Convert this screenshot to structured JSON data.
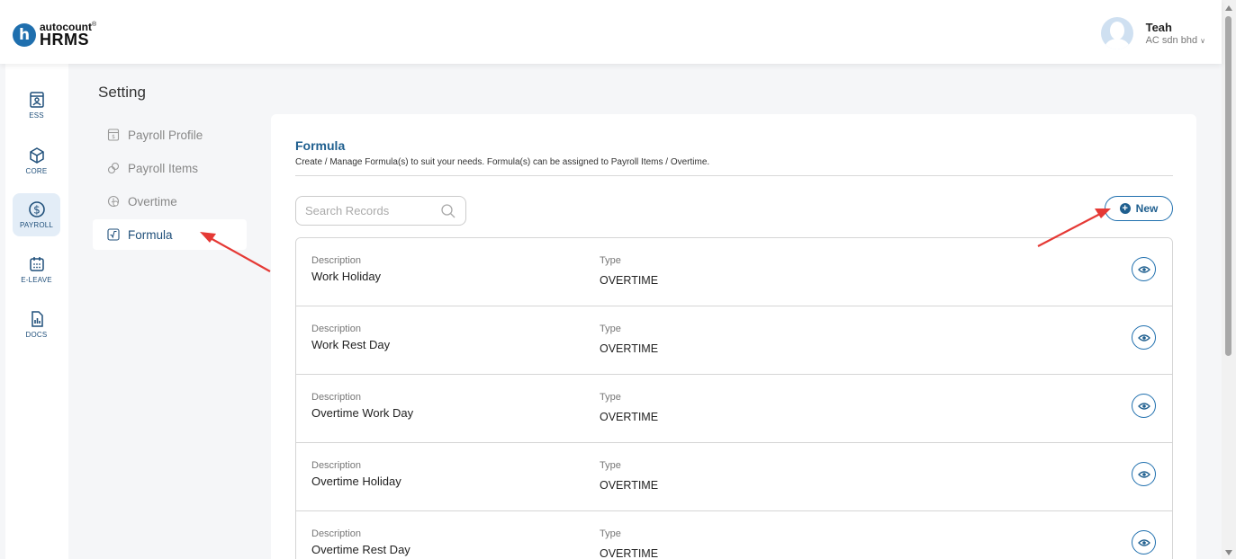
{
  "header": {
    "logo_brand": "autocount",
    "logo_product": "HRMS",
    "user_name": "Teah",
    "company": "AC sdn bhd"
  },
  "rail": {
    "items": [
      {
        "label": "ESS",
        "icon": "id-card-icon"
      },
      {
        "label": "CORE",
        "icon": "cube-icon"
      },
      {
        "label": "PAYROLL",
        "icon": "dollar-circle-icon",
        "active": true
      },
      {
        "label": "E-LEAVE",
        "icon": "calendar-icon"
      },
      {
        "label": "DOCS",
        "icon": "document-chart-icon"
      }
    ]
  },
  "setting": {
    "title": "Setting",
    "menu": [
      {
        "label": "Payroll Profile",
        "icon": "calculator-icon"
      },
      {
        "label": "Payroll Items",
        "icon": "coins-icon"
      },
      {
        "label": "Overtime",
        "icon": "clock-dollar-icon"
      },
      {
        "label": "Formula",
        "icon": "formula-icon",
        "active": true
      }
    ]
  },
  "formula": {
    "title": "Formula",
    "subtitle": "Create / Manage Formula(s) to suit your needs. Formula(s) can be assigned to Payroll Items / Overtime.",
    "search_placeholder": "Search Records",
    "new_label": "New",
    "col_description": "Description",
    "col_type": "Type",
    "rows": [
      {
        "description": "Work Holiday",
        "type": "OVERTIME"
      },
      {
        "description": "Work Rest Day",
        "type": "OVERTIME"
      },
      {
        "description": "Overtime Work Day",
        "type": "OVERTIME"
      },
      {
        "description": "Overtime Holiday",
        "type": "OVERTIME"
      },
      {
        "description": "Overtime Rest Day",
        "type": "OVERTIME"
      }
    ]
  },
  "colors": {
    "primary": "#1f5f8f",
    "accent": "#1f6fae",
    "annotation_arrow": "#e53935"
  }
}
